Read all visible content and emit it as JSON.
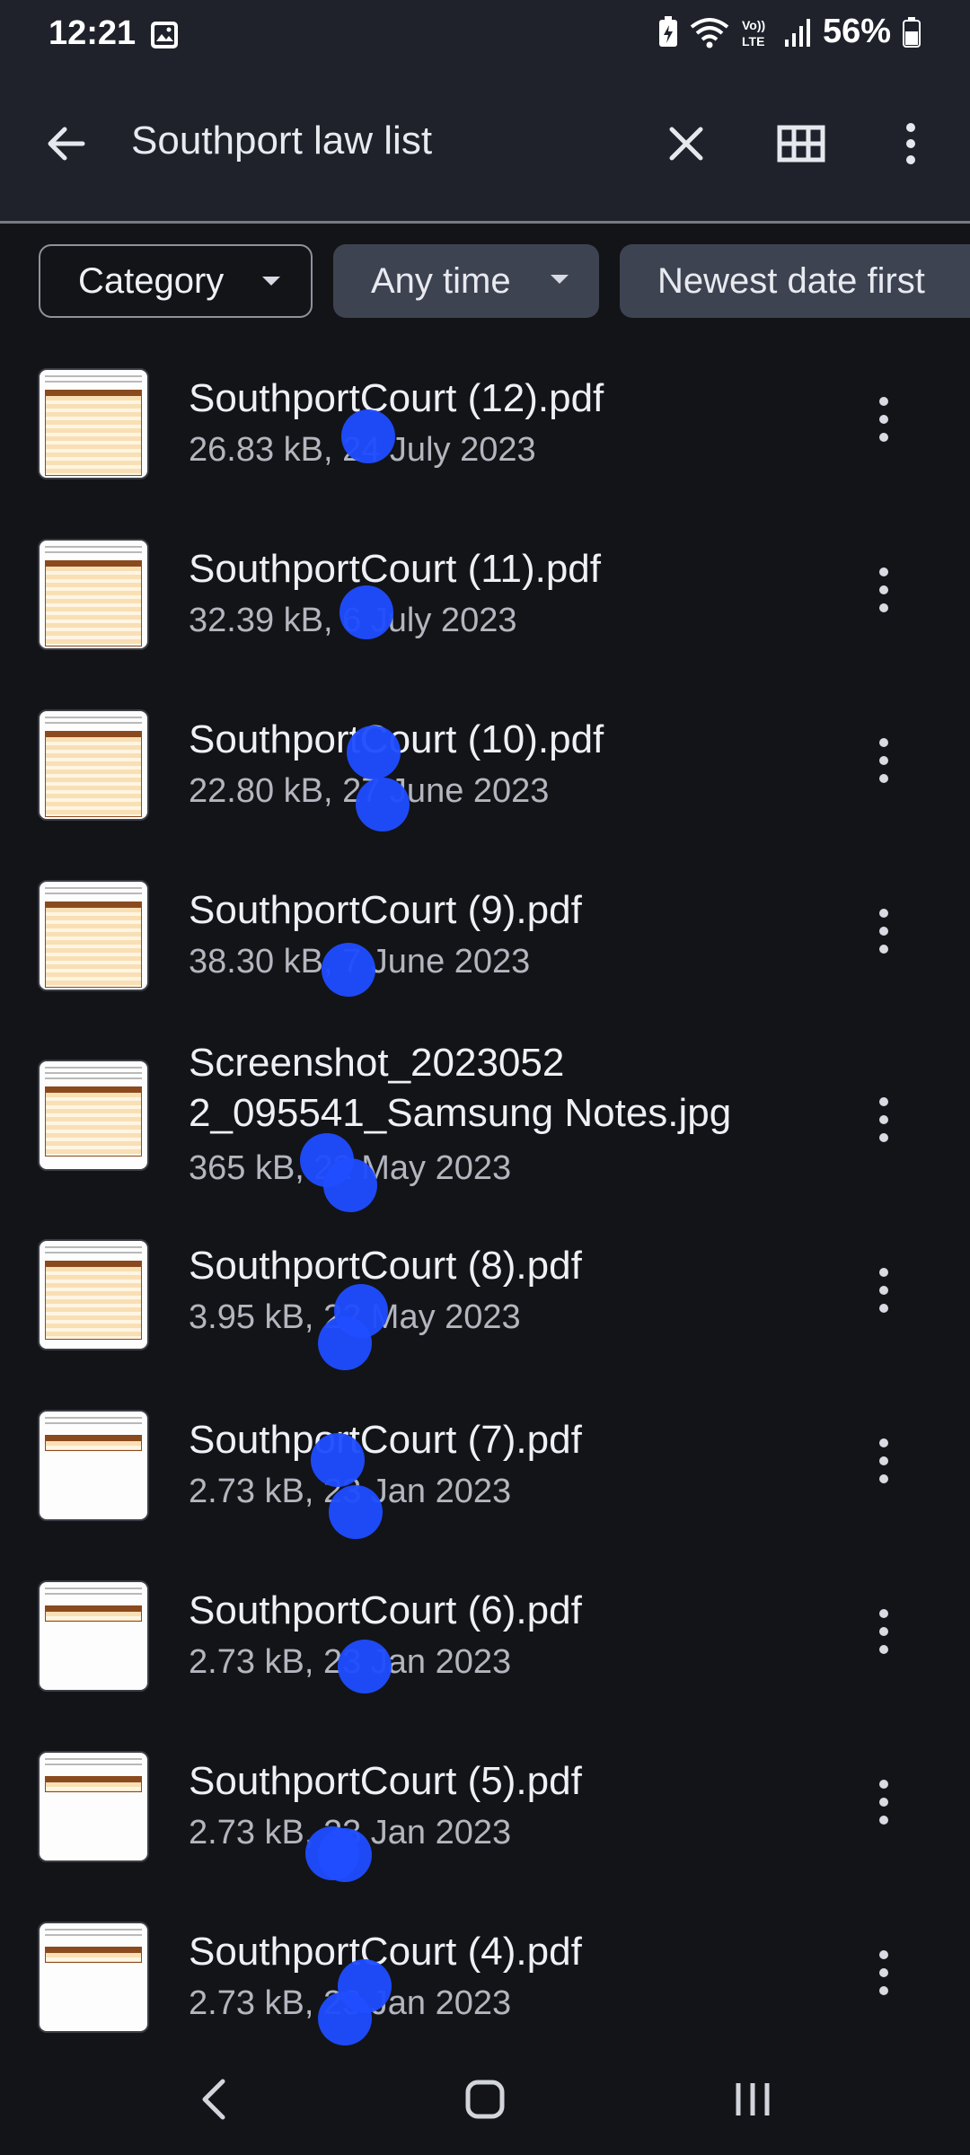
{
  "status_bar": {
    "time": "12:21",
    "battery": "56%"
  },
  "app_bar": {
    "query": "Southport law list"
  },
  "chips": {
    "category": "Category",
    "time": "Any time",
    "sort": "Newest date first"
  },
  "files": [
    {
      "name": "SouthportCourt (12).pdf",
      "meta": "26.83 kB, 24 July 2023"
    },
    {
      "name": "SouthportCourt (11).pdf",
      "meta": "32.39 kB, 6 July 2023"
    },
    {
      "name": "SouthportCourt (10).pdf",
      "meta": "22.80 kB, 27 June 2023"
    },
    {
      "name": "SouthportCourt (9).pdf",
      "meta": "38.30 kB, 7 June 2023"
    },
    {
      "name_line1": "Screenshot_2023052",
      "name_line2": "2_095541_Samsung Notes.jpg",
      "meta": "365 kB, 22 May 2023"
    },
    {
      "name": "SouthportCourt (8).pdf",
      "meta": "3.95 kB, 22 May 2023"
    },
    {
      "name": "SouthportCourt (7).pdf",
      "meta": "2.73 kB, 23 Jan 2023"
    },
    {
      "name": "SouthportCourt (6).pdf",
      "meta": "2.73 kB, 23 Jan 2023"
    },
    {
      "name": "SouthportCourt (5).pdf",
      "meta": "2.73 kB, 23 Jan 2023"
    },
    {
      "name": "SouthportCourt (4).pdf",
      "meta": "2.73 kB, 23 Jan 2023"
    }
  ],
  "colors": {
    "touch_marker": "#1f4dff",
    "background": "#131417",
    "app_bar": "#1f222b"
  }
}
